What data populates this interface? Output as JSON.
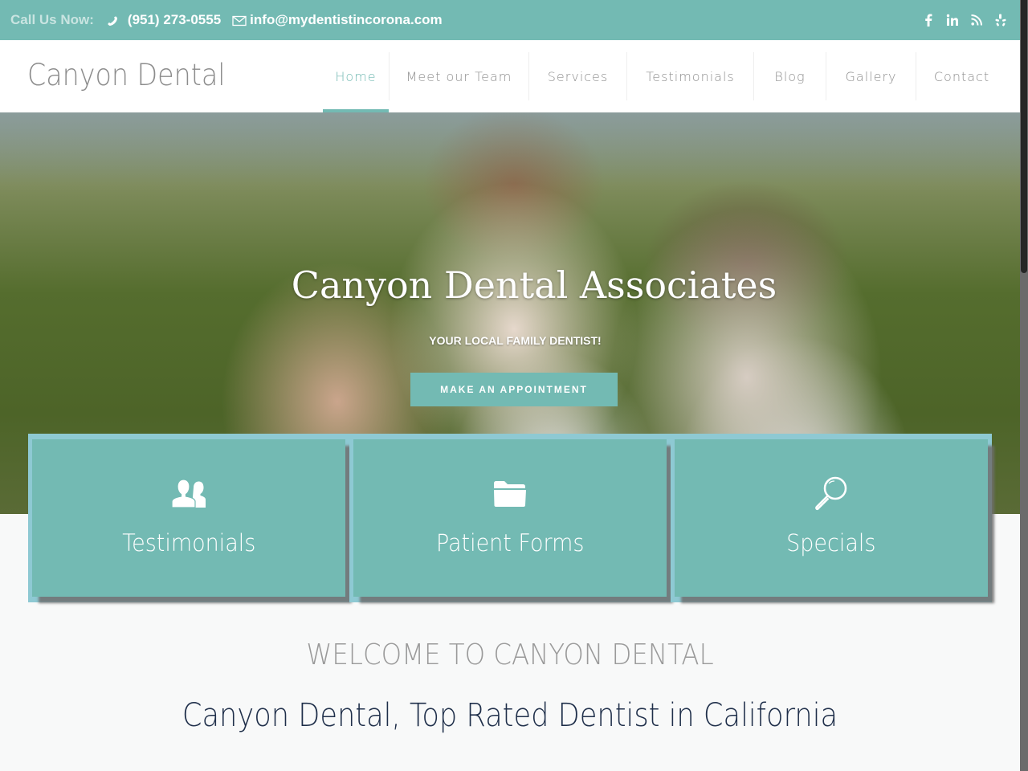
{
  "topbar": {
    "call_label": "Call Us Now:",
    "phone": "(951) 273-0555",
    "email": "info@mydentistincorona.com",
    "social": [
      {
        "name": "facebook-icon",
        "glyph": "f"
      },
      {
        "name": "linkedin-icon",
        "glyph": "in"
      },
      {
        "name": "rss-icon",
        "glyph": "rss"
      },
      {
        "name": "yelp-icon",
        "glyph": "yelp"
      }
    ]
  },
  "header": {
    "logo": "Canyon Dental",
    "nav": [
      {
        "label": "Home",
        "active": true
      },
      {
        "label": "Meet our Team",
        "active": false
      },
      {
        "label": "Services",
        "active": false
      },
      {
        "label": "Testimonials",
        "active": false
      },
      {
        "label": "Blog",
        "active": false
      },
      {
        "label": "Gallery",
        "active": false
      },
      {
        "label": "Contact",
        "active": false
      }
    ]
  },
  "hero": {
    "title": "Canyon Dental Associates",
    "subtitle": "YOUR LOCAL FAMILY DENTIST!",
    "button_label": "MAKE AN APPOINTMENT"
  },
  "cards": [
    {
      "label": "Testimonials",
      "icon": "users-icon"
    },
    {
      "label": "Patient Forms",
      "icon": "folder-icon"
    },
    {
      "label": "Specials",
      "icon": "magnifier-icon"
    }
  ],
  "welcome": {
    "heading": "WELCOME TO CANYON DENTAL",
    "tagline": "Canyon Dental, Top Rated Dentist in California"
  },
  "colors": {
    "brand": "#73bab3",
    "card_frame": "#8ec9d3",
    "tagline": "#1f2f4a"
  }
}
